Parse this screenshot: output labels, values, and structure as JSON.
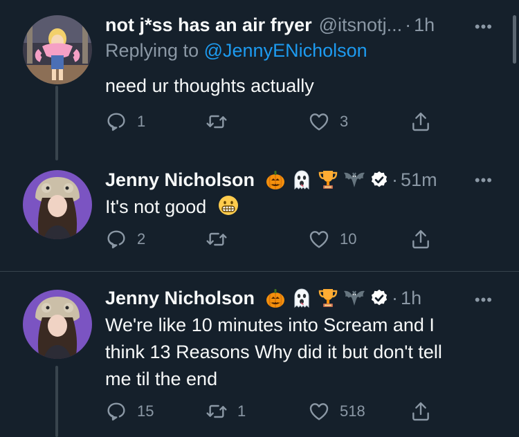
{
  "tweets": [
    {
      "name": "not j*ss has an air fryer",
      "handle": "@itsnotj...",
      "time": "1h",
      "replying_prefix": "Replying to",
      "replying_to": "@JennyENicholson",
      "text": "need ur thoughts actually",
      "replies": "1",
      "retweets": "",
      "likes": "3"
    },
    {
      "name": "Jenny Nicholson",
      "time": "51m",
      "text": "It's not good",
      "replies": "2",
      "retweets": "",
      "likes": "10"
    },
    {
      "name": "Jenny Nicholson",
      "time": "1h",
      "text_lines": [
        "We're like 10 minutes into Scream and I",
        "think 13 Reasons Why did it but don't tell",
        "me til the end"
      ],
      "replies": "15",
      "retweets": "1",
      "likes": "518"
    }
  ],
  "separator": "·",
  "more_glyph": "•••",
  "icons": {
    "reply": "reply-icon",
    "retweet": "retweet-icon",
    "like": "heart-icon",
    "share": "share-icon",
    "verified": "verified-badge-icon",
    "badges": [
      "pumpkin-emoji",
      "ghost-emoji",
      "trophy-emoji",
      "bat-emoji"
    ],
    "grimace": "grimacing-face-emoji"
  },
  "colors": {
    "background": "#15202b",
    "text": "#f7f9f9",
    "muted": "#8b98a5",
    "link": "#1d9bf0",
    "divider": "#38444d"
  }
}
